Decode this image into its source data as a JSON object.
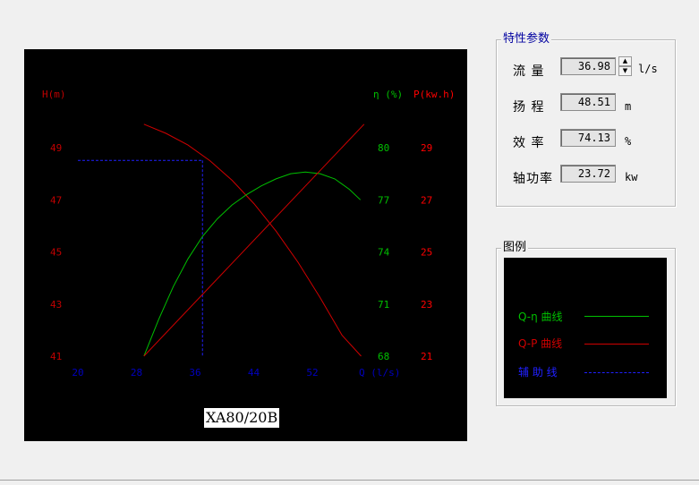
{
  "params": {
    "title": "特性参数",
    "rows": [
      {
        "label": "流 量",
        "value": "36.98",
        "unit": "l/s"
      },
      {
        "label": "扬 程",
        "value": "48.51",
        "unit": "m"
      },
      {
        "label": "效 率",
        "value": "74.13",
        "unit": "%"
      },
      {
        "label": "轴功率",
        "value": "23.72",
        "unit": "kw"
      }
    ],
    "spinner_up": "▲",
    "spinner_down": "▼"
  },
  "legend": {
    "title": "图例",
    "items": [
      {
        "label": "Q-η 曲线",
        "color": "#00c000",
        "style": "solid"
      },
      {
        "label": "Q-P 曲线",
        "color": "#d00000",
        "style": "solid"
      },
      {
        "label": "辅 助 线",
        "color": "#2020ff",
        "style": "dashed"
      }
    ]
  },
  "model_label": "XA80/20B",
  "chart_data": {
    "type": "line",
    "xlabel": "Q (l/s)",
    "ylabel_left": "H(m)",
    "ylabel_right1": "η (%)",
    "ylabel_right2": "P(kw.h)",
    "x_ticks": [
      "20",
      "28",
      "36",
      "44",
      "52"
    ],
    "xlim": [
      20,
      60
    ],
    "y_left_ticks": [
      "49",
      "47",
      "45",
      "43",
      "41"
    ],
    "y_left_lim": [
      41,
      50
    ],
    "y_eff_ticks": [
      "80",
      "77",
      "74",
      "71",
      "68"
    ],
    "y_eff_lim": [
      68,
      81
    ],
    "y_pow_ticks": [
      "29",
      "27",
      "25",
      "23",
      "21"
    ],
    "y_pow_lim": [
      21,
      30
    ],
    "colors": {
      "head": "#d00000",
      "efficiency": "#00c000",
      "power": "#d00000",
      "aux": "#2020ff",
      "h_axis": "#c00000",
      "eff_axis": "#00c000",
      "pow_axis": "#ff0000",
      "x_axis": "#0000c0"
    },
    "series": [
      {
        "key": "head",
        "axis": "left",
        "x": [
          29,
          32,
          35,
          38,
          41,
          44,
          47,
          50,
          53,
          56,
          58.6
        ],
        "y": [
          49.9,
          49.55,
          49.1,
          48.5,
          47.75,
          46.85,
          45.8,
          44.6,
          43.25,
          41.8,
          41.0
        ]
      },
      {
        "key": "efficiency",
        "axis": "eff",
        "x": [
          29,
          31,
          33,
          35,
          37,
          39,
          41,
          43,
          45,
          47,
          49,
          51,
          53,
          55,
          57,
          58.5
        ],
        "y": [
          68.0,
          70.1,
          72.0,
          73.6,
          74.9,
          75.9,
          76.7,
          77.3,
          77.8,
          78.2,
          78.5,
          78.6,
          78.5,
          78.2,
          77.6,
          77.0
        ]
      },
      {
        "key": "power",
        "axis": "pow",
        "x": [
          29,
          59
        ],
        "y": [
          21.0,
          29.9
        ]
      }
    ],
    "operating_point": {
      "x": 36.98,
      "y": 48.51
    }
  }
}
